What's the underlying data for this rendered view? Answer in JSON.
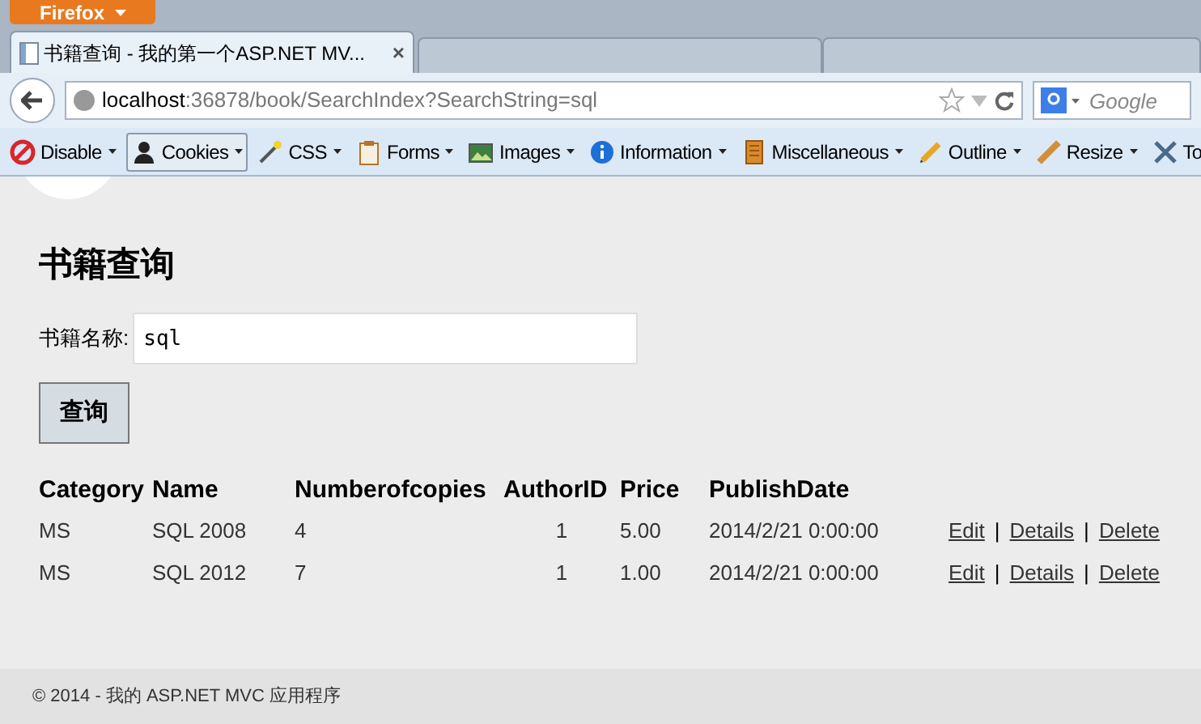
{
  "browser": {
    "menu_button": "Firefox",
    "tab": {
      "title": "书籍查询 - 我的第一个ASP.NET MV...",
      "close": "×"
    },
    "url": {
      "host": "localhost",
      "rest": ":36878/book/SearchIndex?SearchString=sql"
    },
    "search": {
      "placeholder": "Google"
    }
  },
  "toolbar": [
    {
      "label": "Disable",
      "pressed": false
    },
    {
      "label": "Cookies",
      "pressed": true
    },
    {
      "label": "CSS",
      "pressed": false
    },
    {
      "label": "Forms",
      "pressed": false
    },
    {
      "label": "Images",
      "pressed": false
    },
    {
      "label": "Information",
      "pressed": false
    },
    {
      "label": "Miscellaneous",
      "pressed": false
    },
    {
      "label": "Outline",
      "pressed": false
    },
    {
      "label": "Resize",
      "pressed": false
    },
    {
      "label": "To",
      "pressed": false
    }
  ],
  "page": {
    "heading": "书籍查询",
    "field_label": "书籍名称:",
    "field_value": "sql",
    "submit": "查询",
    "table": {
      "columns": [
        "Category",
        "Name",
        "Numberofcopies",
        "AuthorID",
        "Price",
        "PublishDate"
      ],
      "rows": [
        {
          "cells": [
            "MS",
            "SQL 2008",
            "4",
            "1",
            "5.00",
            "2014/2/21 0:00:00"
          ],
          "actions": [
            {
              "kind": "link",
              "text": "Edit"
            },
            {
              "kind": "separator",
              "text": "|"
            },
            {
              "kind": "link",
              "text": "Details"
            },
            {
              "kind": "separator",
              "text": "|"
            },
            {
              "kind": "link",
              "text": "Delete"
            }
          ]
        },
        {
          "cells": [
            "MS",
            "SQL 2012",
            "7",
            "1",
            "1.00",
            "2014/2/21 0:00:00"
          ],
          "actions": [
            {
              "kind": "link",
              "text": "Edit"
            },
            {
              "kind": "separator",
              "text": "|"
            },
            {
              "kind": "link",
              "text": "Details"
            },
            {
              "kind": "separator",
              "text": "|"
            },
            {
              "kind": "link",
              "text": "Delete"
            }
          ]
        }
      ]
    },
    "footer": "© 2014 - 我的 ASP.NET MVC 应用程序"
  }
}
